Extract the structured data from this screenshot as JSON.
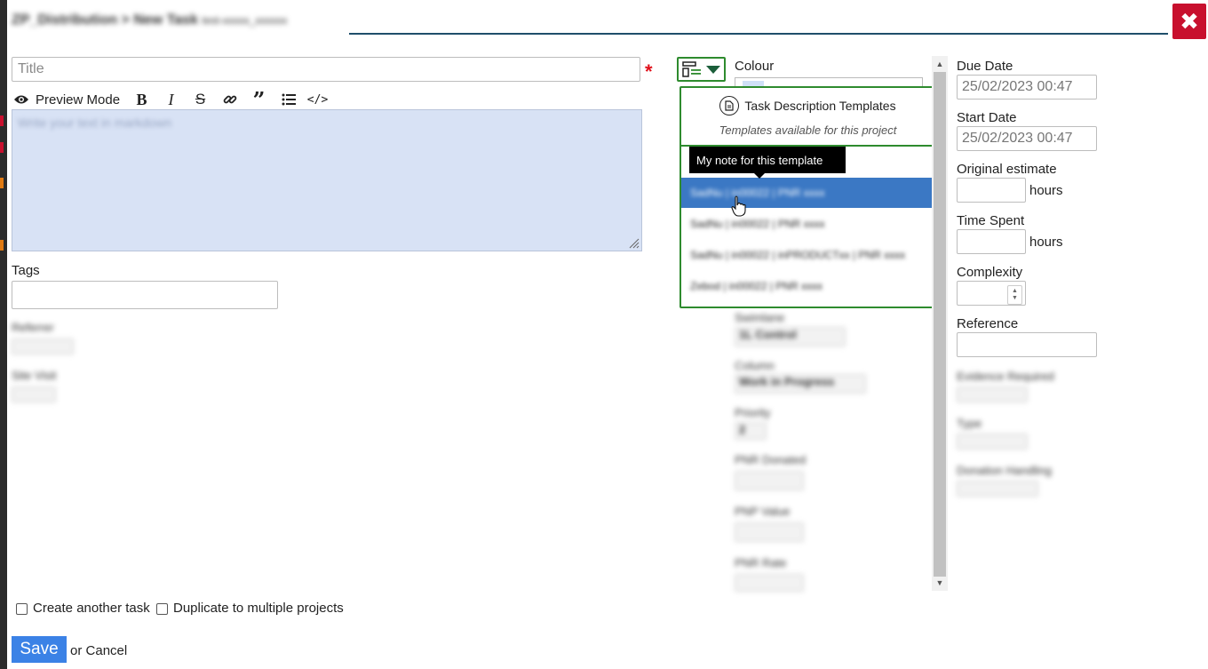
{
  "header": {
    "title": "ZP_Distribution > New Task",
    "subtitle": "test-xxxxx_xxxxxx"
  },
  "editor": {
    "title_placeholder": "Title",
    "required_mark": "*",
    "preview_mode_label": "Preview Mode",
    "toolbar_icons": [
      "eye-icon",
      "bold-icon",
      "italic-icon",
      "strikethrough-icon",
      "link-icon",
      "quote-icon",
      "list-icon",
      "code-icon"
    ],
    "description_placeholder": "Write your text in markdown",
    "tags_label": "Tags",
    "reference_label": "Referrer",
    "site_visit_label": "Site Visit"
  },
  "templates": {
    "colour_label": "Colour",
    "header_title": "Task Description Templates",
    "header_subtitle": "Templates available for this project",
    "tooltip": "My note for this template",
    "items": [
      "SadNu | in00022 | PNR xxxx",
      "SadNu | in00022 | PNR xxxx",
      "SadNu | in00022 | inPRODUCTxx | PNR xxxx",
      "Zebod | in00022 | PNR xxxx"
    ],
    "selected_index": 0
  },
  "middle": {
    "swimlane_label": "Swimlane",
    "swimlane_value": "1L Control",
    "column_label": "Column",
    "column_value": "Work in Progress",
    "priority_label": "Priority",
    "priority_value": "2",
    "pnr_donated_label": "PNR Donated",
    "pnr_value_label": "PNP Value",
    "pnr_rate_label": "PNR Rate"
  },
  "right": {
    "due_date_label": "Due Date",
    "due_date_value": "25/02/2023 00:47",
    "start_date_label": "Start Date",
    "start_date_value": "25/02/2023 00:47",
    "original_estimate_label": "Original estimate",
    "time_spent_label": "Time Spent",
    "hours_label": "hours",
    "complexity_label": "Complexity",
    "reference_label": "Reference",
    "evidence_label": "Evidence Required",
    "type_label": "Type",
    "donation_label": "Donation Handling"
  },
  "footer": {
    "create_another_label": "Create another task",
    "duplicate_label": "Duplicate to multiple projects",
    "save_label": "Save",
    "or_label": "or",
    "cancel_label": "Cancel"
  },
  "colors": {
    "accent_green": "#2e8b2e",
    "close_red": "#c8102e",
    "selected_blue": "#3b78c4",
    "save_blue": "#3b82e6",
    "editor_bg": "#d8e2f5"
  }
}
